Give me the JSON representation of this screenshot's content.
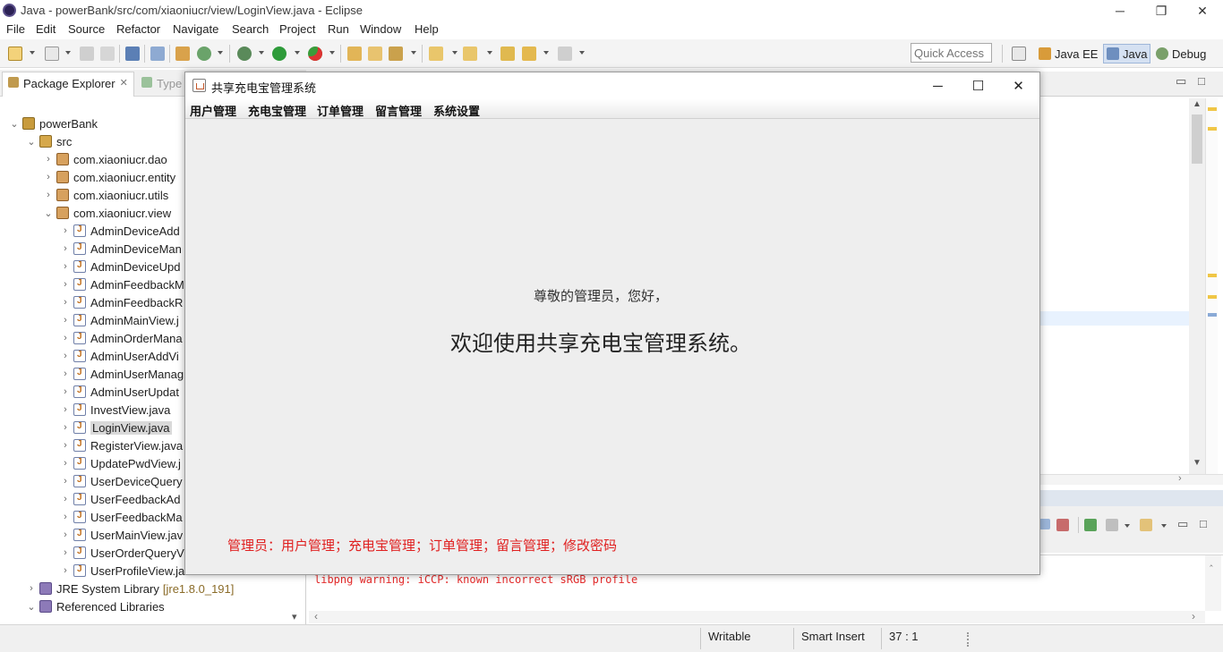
{
  "window": {
    "title": "Java - powerBank/src/com/xiaoniucr/view/LoginView.java - Eclipse",
    "controls": [
      "─",
      "❐",
      "✕"
    ]
  },
  "menu": [
    "File",
    "Edit",
    "Source",
    "Refactor",
    "Navigate",
    "Search",
    "Project",
    "Run",
    "Window",
    "Help"
  ],
  "toolbar": {
    "quick_access": "Quick Access",
    "perspectives": [
      "Java EE",
      "Java",
      "Debug"
    ],
    "active_perspective": "Java"
  },
  "package_explorer": {
    "tab_label": "Package Explorer",
    "tab_close": "✕",
    "second_tab": "Type",
    "tree": [
      {
        "label": "powerBank",
        "level": 0,
        "expanded": true,
        "icon": "project-icon"
      },
      {
        "label": "src",
        "level": 1,
        "expanded": true,
        "icon": "source-folder-icon"
      },
      {
        "label": "com.xiaoniucr.dao",
        "level": 2,
        "expanded": false,
        "icon": "package-icon"
      },
      {
        "label": "com.xiaoniucr.entity",
        "level": 2,
        "expanded": false,
        "icon": "package-icon"
      },
      {
        "label": "com.xiaoniucr.utils",
        "level": 2,
        "expanded": false,
        "icon": "package-icon"
      },
      {
        "label": "com.xiaoniucr.view",
        "level": 2,
        "expanded": true,
        "icon": "package-icon"
      },
      {
        "label": "AdminDeviceAdd",
        "level": 3,
        "expanded": false,
        "icon": "java-file-icon"
      },
      {
        "label": "AdminDeviceMan",
        "level": 3,
        "expanded": false,
        "icon": "java-file-icon"
      },
      {
        "label": "AdminDeviceUpd",
        "level": 3,
        "expanded": false,
        "icon": "java-file-icon"
      },
      {
        "label": "AdminFeedbackM",
        "level": 3,
        "expanded": false,
        "icon": "java-file-icon"
      },
      {
        "label": "AdminFeedbackR",
        "level": 3,
        "expanded": false,
        "icon": "java-file-icon"
      },
      {
        "label": "AdminMainView.j",
        "level": 3,
        "expanded": false,
        "icon": "java-file-icon"
      },
      {
        "label": "AdminOrderMana",
        "level": 3,
        "expanded": false,
        "icon": "java-file-icon"
      },
      {
        "label": "AdminUserAddVi",
        "level": 3,
        "expanded": false,
        "icon": "java-file-icon"
      },
      {
        "label": "AdminUserManag",
        "level": 3,
        "expanded": false,
        "icon": "java-file-icon"
      },
      {
        "label": "AdminUserUpdat",
        "level": 3,
        "expanded": false,
        "icon": "java-file-icon"
      },
      {
        "label": "InvestView.java",
        "level": 3,
        "expanded": false,
        "icon": "java-file-icon"
      },
      {
        "label": "LoginView.java",
        "level": 3,
        "expanded": false,
        "icon": "java-file-icon",
        "selected": true
      },
      {
        "label": "RegisterView.java",
        "level": 3,
        "expanded": false,
        "icon": "java-file-icon"
      },
      {
        "label": "UpdatePwdView.j",
        "level": 3,
        "expanded": false,
        "icon": "java-file-icon"
      },
      {
        "label": "UserDeviceQuery",
        "level": 3,
        "expanded": false,
        "icon": "java-file-icon"
      },
      {
        "label": "UserFeedbackAd",
        "level": 3,
        "expanded": false,
        "icon": "java-file-icon"
      },
      {
        "label": "UserFeedbackMa",
        "level": 3,
        "expanded": false,
        "icon": "java-file-icon"
      },
      {
        "label": "UserMainView.jav",
        "level": 3,
        "expanded": false,
        "icon": "java-file-icon"
      },
      {
        "label": "UserOrderQueryV",
        "level": 3,
        "expanded": false,
        "icon": "java-file-icon"
      },
      {
        "label": "UserProfileView.ja",
        "level": 3,
        "expanded": false,
        "icon": "java-file-icon"
      },
      {
        "label": "JRE System Library",
        "suffix": "[jre1.8.0_191]",
        "level": 1,
        "expanded": false,
        "icon": "library-icon"
      },
      {
        "label": "Referenced Libraries",
        "level": 1,
        "expanded": true,
        "icon": "library-icon"
      }
    ]
  },
  "console": {
    "line": "libpng warning: iCCP: known incorrect sRGB profile"
  },
  "statusbar": {
    "writable": "Writable",
    "insert_mode": "Smart Insert",
    "position": "37 : 1"
  },
  "dialog": {
    "title": "共享充电宝管理系统",
    "controls": [
      "─",
      "☐",
      "✕"
    ],
    "menu": [
      "用户管理",
      "充电宝管理",
      "订单管理",
      "留言管理",
      "系统设置"
    ],
    "greeting": "尊敬的管理员，您好，",
    "welcome": "欢迎使用共享充电宝管理系统。",
    "permissions": "管理员：用户管理；充电宝管理；订单管理；留言管理；修改密码"
  },
  "colors": {
    "permission_text": "#e02020",
    "console_error": "#e52b2b",
    "perspective_active": "#d5e1f2"
  }
}
